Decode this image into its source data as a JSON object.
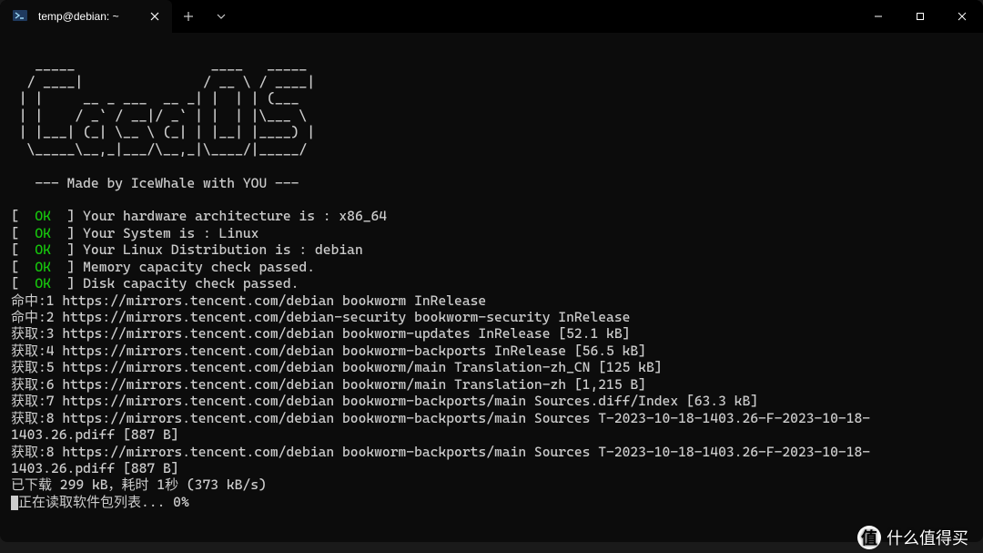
{
  "window": {
    "tab_title": "temp@debian: ~",
    "powershell_prefix": "❯_"
  },
  "ascii": {
    "l1": "   _____                 ____   _____ ",
    "l2": "  / ____|               / __ \\ / ____|",
    "l3": " | |     __ _ ___  __ _| |  | | (___  ",
    "l4": " | |    / _` / __|/ _` | |  | |\\___ \\ ",
    "l5": " | |___| (_| \\__ \\ (_| | |__| |____) |",
    "l6": "  \\_____\\__,_|___/\\__,_|\\____/|_____/ ",
    "tag": "   --- Made by IceWhale with YOU ---"
  },
  "checks": [
    "Your hardware architecture is : x86_64",
    "Your System is : Linux",
    "Your Linux Distribution is : debian",
    "Memory capacity check passed.",
    "Disk capacity check passed."
  ],
  "apt": [
    "命中:1 https://mirrors.tencent.com/debian bookworm InRelease",
    "命中:2 https://mirrors.tencent.com/debian-security bookworm-security InRelease",
    "获取:3 https://mirrors.tencent.com/debian bookworm-updates InRelease [52.1 kB]",
    "获取:4 https://mirrors.tencent.com/debian bookworm-backports InRelease [56.5 kB]",
    "获取:5 https://mirrors.tencent.com/debian bookworm/main Translation-zh_CN [125 kB]",
    "获取:6 https://mirrors.tencent.com/debian bookworm/main Translation-zh [1,215 B]",
    "获取:7 https://mirrors.tencent.com/debian bookworm-backports/main Sources.diff/Index [63.3 kB]",
    "获取:8 https://mirrors.tencent.com/debian bookworm-backports/main Sources T-2023-10-18-1403.26-F-2023-10-18-1403.26.pdiff [887 B]",
    "获取:8 https://mirrors.tencent.com/debian bookworm-backports/main Sources T-2023-10-18-1403.26-F-2023-10-18-1403.26.pdiff [887 B]",
    "已下载 299 kB，耗时 1秒 (373 kB/s)",
    "正在读取软件包列表... 0%"
  ],
  "watermark": {
    "badge": "值",
    "text": "什么值得买"
  }
}
